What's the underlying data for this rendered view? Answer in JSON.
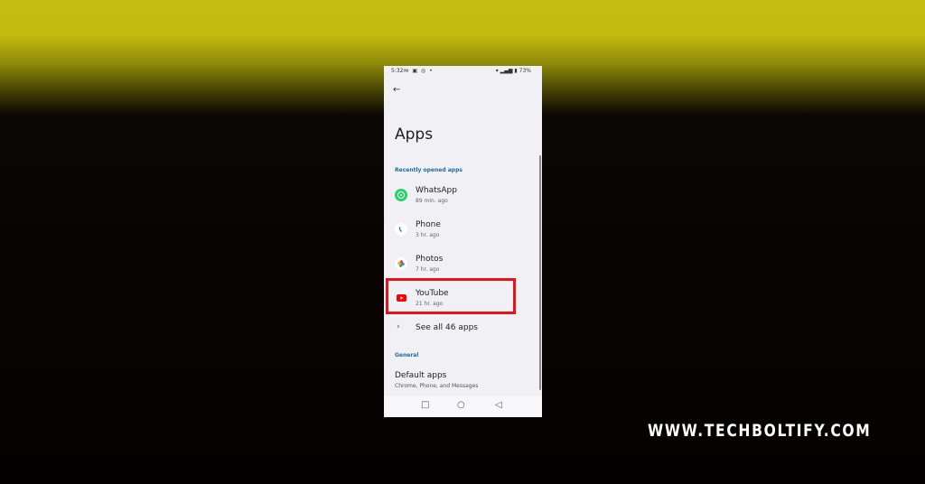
{
  "status_bar": {
    "time": "5:32",
    "ampm": "PM",
    "battery": "73%"
  },
  "page": {
    "title": "Apps",
    "recent_section": "Recently opened apps",
    "general_section": "General"
  },
  "recent_apps": [
    {
      "name": "WhatsApp",
      "ago": "89 min. ago",
      "icon": "whatsapp-icon",
      "color": "#25d366"
    },
    {
      "name": "Phone",
      "ago": "3 hr. ago",
      "icon": "phone-icon",
      "color": "#1a73e8"
    },
    {
      "name": "Photos",
      "ago": "7 hr. ago",
      "icon": "photos-icon",
      "color": "#ea4335"
    },
    {
      "name": "YouTube",
      "ago": "21 hr. ago",
      "icon": "youtube-icon",
      "color": "#ff0000"
    }
  ],
  "see_all": "See all 46 apps",
  "default_apps": {
    "title": "Default apps",
    "subtitle": "Chrome, Phone, and Messages"
  },
  "watermark": "WWW.TECHBOLTIFY.COM",
  "highlight_color": "#e8121b"
}
